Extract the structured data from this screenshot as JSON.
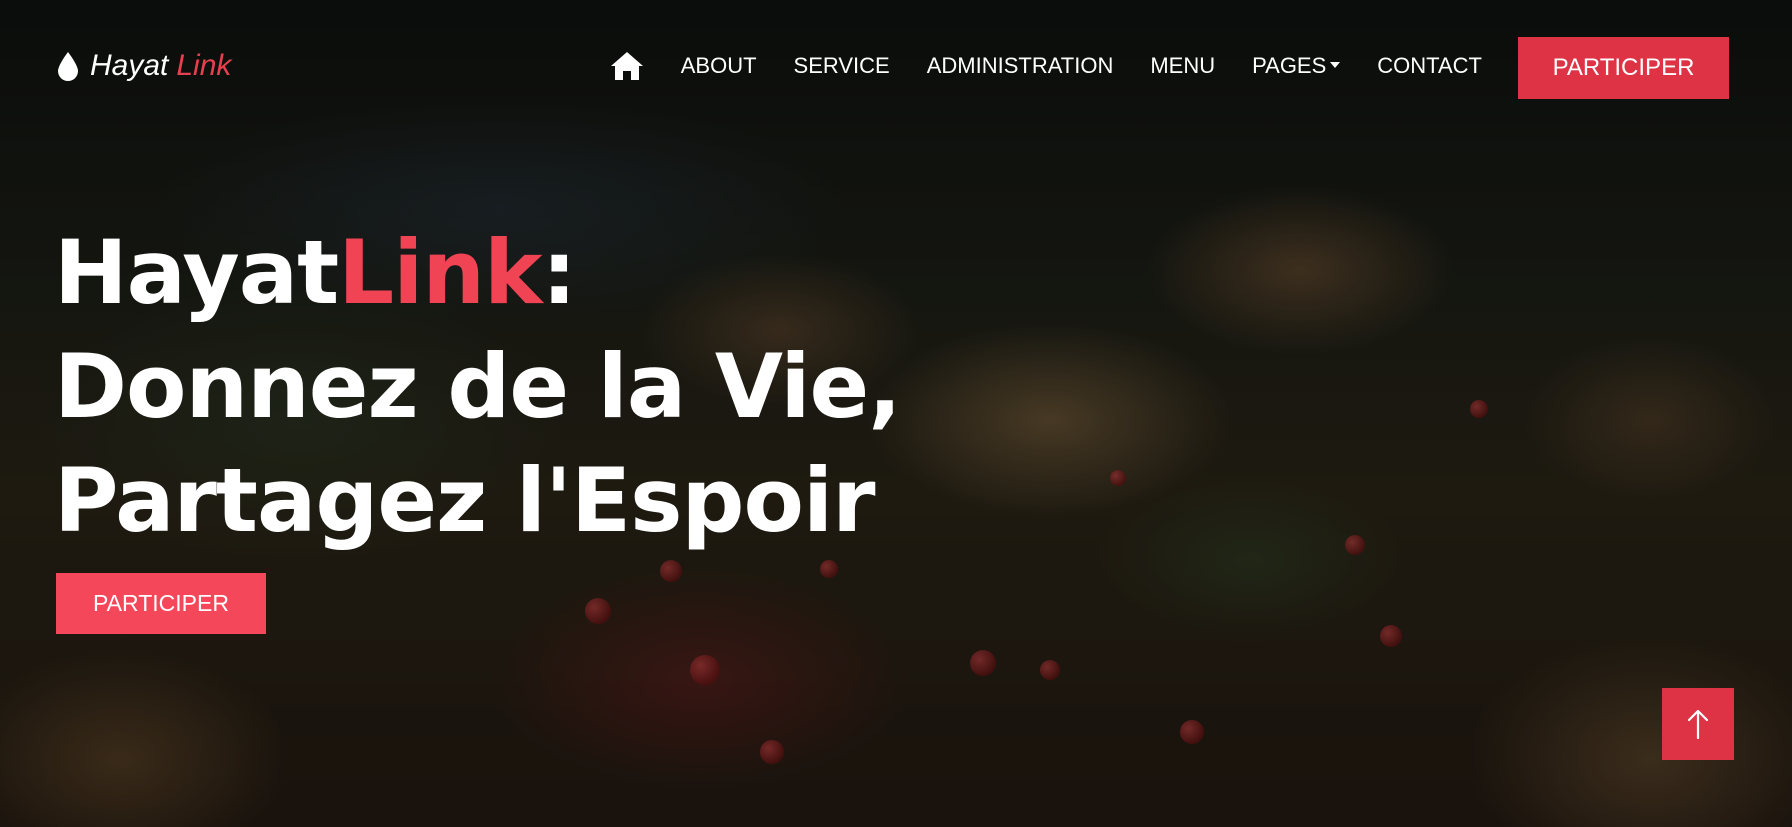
{
  "brand": {
    "name_main": "Hayat",
    "name_accent": "Link",
    "icon": "drop-icon"
  },
  "nav": {
    "home_icon": "home-icon",
    "items": [
      {
        "label": "ABOUT"
      },
      {
        "label": "SERVICE"
      },
      {
        "label": "ADMINISTRATION"
      },
      {
        "label": "MENU"
      },
      {
        "label": "PAGES",
        "has_dropdown": true
      },
      {
        "label": "CONTACT"
      }
    ],
    "cta_label": "PARTICIPER"
  },
  "hero": {
    "title_main": "Hayat",
    "title_accent": "Link",
    "title_colon": ":",
    "line2": "Donnez de la Vie,",
    "line3": "Partagez l'Espoir",
    "cta_label": "PARTICIPER"
  },
  "back_to_top": {
    "icon": "arrow-up-icon"
  },
  "colors": {
    "accent": "#dd3344",
    "accent_text": "#f04454",
    "text": "#ffffff"
  }
}
